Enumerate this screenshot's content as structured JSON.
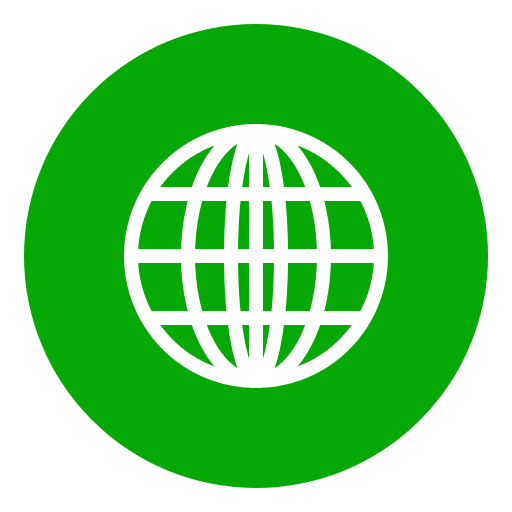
{
  "icon": {
    "name": "globe-icon",
    "background_color": "#05A805",
    "glyph_color": "#FFFFFF",
    "shape": "circle"
  }
}
